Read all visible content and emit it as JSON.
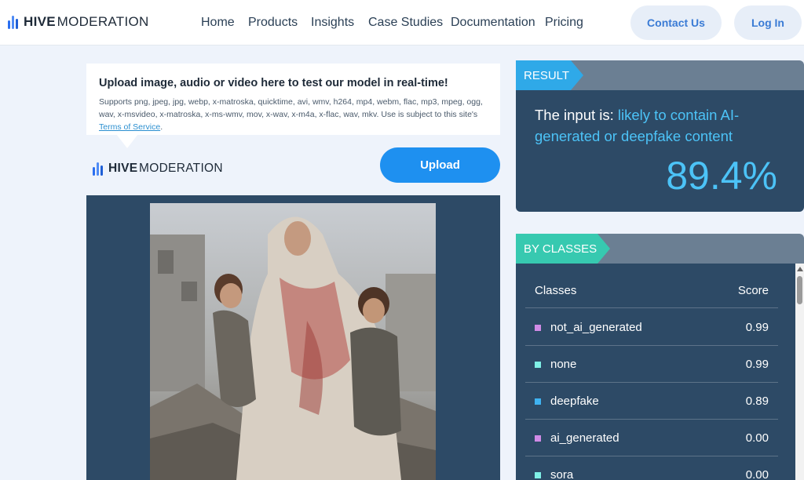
{
  "header": {
    "brand_bold": "HIVE",
    "brand_rest": "MODERATION",
    "nav": [
      "Home",
      "Products",
      "Insights",
      "Case Studies",
      "Documentation",
      "Pricing"
    ],
    "contact_label": "Contact Us",
    "login_label": "Log In"
  },
  "upload": {
    "title": "Upload image, audio or video here to test our model in real-time!",
    "desc": "Supports png, jpeg, jpg, webp, x-matroska, quicktime, avi, wmv, h264, mp4, webm, flac, mp3, mpeg, ogg, wav, x-msvideo, x-matroska, x-ms-wmv, mov, x-wav, x-m4a, x-flac, wav, mkv. Use is subject to this site's ",
    "tos_label": "Terms of Service",
    "desc_end": ".",
    "button_label": "Upload"
  },
  "result": {
    "tag": "RESULT",
    "prefix": "The input is: ",
    "verdict": "likely to contain AI-generated or deepfake content",
    "percent": "89.4%"
  },
  "classes": {
    "tag": "BY CLASSES",
    "col_class": "Classes",
    "col_score": "Score",
    "rows": [
      {
        "name": "not_ai_generated",
        "score": "0.99",
        "color": "#d08be6"
      },
      {
        "name": "none",
        "score": "0.99",
        "color": "#7ff0e6"
      },
      {
        "name": "deepfake",
        "score": "0.89",
        "color": "#3fb3f2"
      },
      {
        "name": "ai_generated",
        "score": "0.00",
        "color": "#d08be6"
      },
      {
        "name": "sora",
        "score": "0.00",
        "color": "#7ff0e6"
      }
    ]
  },
  "colors": {
    "accent": "#1e90f0",
    "panel": "#2d4a66",
    "highlight": "#4cc3f7",
    "result_tag": "#2fa9e8",
    "classes_tag": "#37c9b0"
  }
}
